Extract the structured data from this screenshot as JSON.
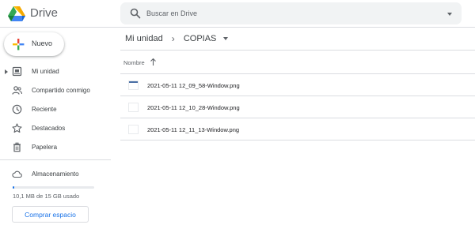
{
  "app": {
    "name": "Drive"
  },
  "search": {
    "placeholder": "Buscar en Drive"
  },
  "sidebar": {
    "new_button": "Nuevo",
    "items": [
      {
        "label": "Mi unidad",
        "icon": "my-drive-icon",
        "expandable": true
      },
      {
        "label": "Compartido conmigo",
        "icon": "shared-icon"
      },
      {
        "label": "Reciente",
        "icon": "clock-icon"
      },
      {
        "label": "Destacados",
        "icon": "star-icon"
      },
      {
        "label": "Papelera",
        "icon": "trash-icon"
      }
    ],
    "storage": {
      "label": "Almacenamiento",
      "icon": "cloud-icon",
      "usage_text": "10,1 MB de 15 GB usado",
      "used_fraction": 0.01,
      "buy_button": "Comprar espacio"
    }
  },
  "main": {
    "breadcrumb": [
      "Mi unidad",
      "COPIAS"
    ],
    "column_header": "Nombre",
    "sort": "ascending",
    "files": [
      {
        "name": "2021-05-11 12_09_58-Window.png"
      },
      {
        "name": "2021-05-11 12_10_28-Window.png"
      },
      {
        "name": "2021-05-11 12_11_13-Window.png"
      }
    ]
  },
  "colors": {
    "accent": "#1a73e8",
    "text": "#202124",
    "muted": "#5f6368",
    "divider": "#dadce0",
    "search_bg": "#f1f3f4"
  }
}
